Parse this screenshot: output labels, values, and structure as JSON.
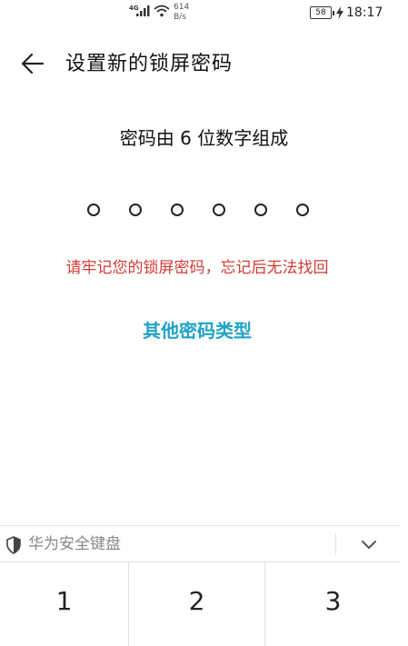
{
  "status_bar": {
    "network": "4G",
    "speed_value": "614",
    "speed_unit": "B/s",
    "battery": "58",
    "time": "18:17"
  },
  "header": {
    "title": "设置新的锁屏密码"
  },
  "main": {
    "subtitle": "密码由 6 位数字组成",
    "pin_length": 6,
    "pin_entered": 0,
    "warning": "请牢记您的锁屏密码，忘记后无法找回",
    "other_type_label": "其他密码类型"
  },
  "keyboard": {
    "title": "华为安全键盘",
    "keys": [
      "1",
      "2",
      "3"
    ]
  },
  "colors": {
    "warning": "#d23b36",
    "link": "#1fa3c7"
  }
}
